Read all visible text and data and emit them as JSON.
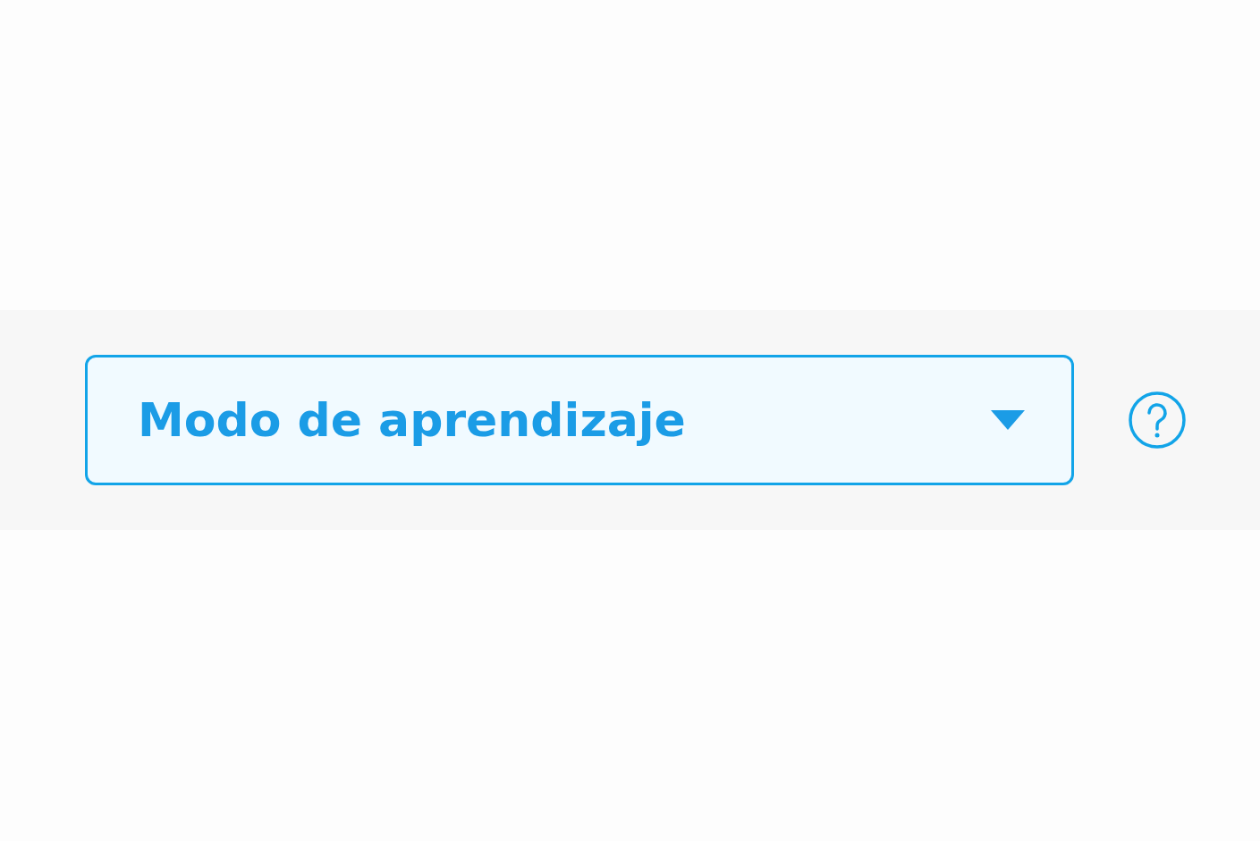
{
  "mode_select": {
    "value": "Modo de aprendizaje"
  }
}
